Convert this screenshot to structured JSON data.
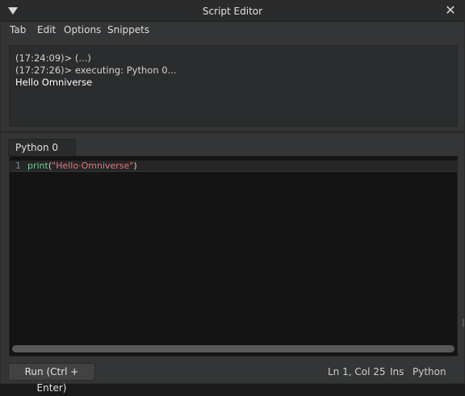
{
  "window": {
    "title": "Script Editor",
    "close_glyph": "✕"
  },
  "menu": {
    "items": [
      "Tab",
      "Edit",
      "Options",
      "Snippets"
    ]
  },
  "output": {
    "lines": [
      "(17:24:09)> (...)",
      "(17:27:26)> executing: Python 0...",
      "Hello Omniverse"
    ]
  },
  "tabs": [
    {
      "label": "Python 0",
      "active": true
    }
  ],
  "editor": {
    "line_number": "1",
    "code": {
      "keyword": "print",
      "open_paren": "(",
      "string": "\"Hello·Omniverse\"",
      "close_paren": ")"
    }
  },
  "status": {
    "run_label": "Run (Ctrl + Enter)",
    "cursor": "Ln 1, Col 25",
    "mode": "Ins",
    "language": "Python"
  },
  "colors": {
    "keyword": "#6fce92",
    "string": "#e57979",
    "line_number": "#7c8794"
  },
  "icons": {
    "collapse": "triangle-down-icon",
    "close": "close-icon"
  }
}
